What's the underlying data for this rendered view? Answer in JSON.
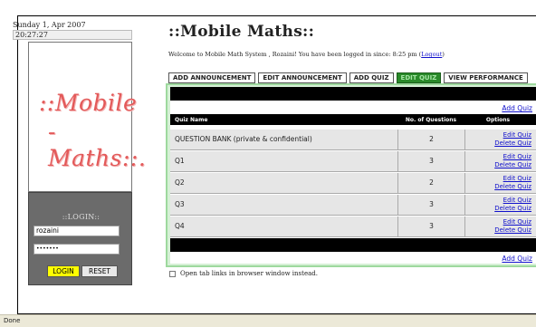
{
  "sidebar": {
    "date": "Sunday 1, Apr 2007",
    "time": "20:27:27",
    "logo": {
      "line1": "::Mobile",
      "line2": "-Maths::."
    },
    "login": {
      "title": "::LOGIN::",
      "username": "rozaini",
      "password_mask": "•••••••",
      "login_label": "LOGIN",
      "reset_label": "RESET"
    }
  },
  "header": {
    "title": "::Mobile Maths::",
    "welcome_text": "Welcome to Mobile Math System , Rozaini! You have been logged in since: 8:25 pm (",
    "logout_label": "Logout",
    "welcome_close": ")"
  },
  "tabs": [
    {
      "label": "ADD ANNOUNCEMENT",
      "active": false
    },
    {
      "label": "EDIT ANNOUNCEMENT",
      "active": false
    },
    {
      "label": "ADD QUIZ",
      "active": false
    },
    {
      "label": "EDIT QUIZ",
      "active": true
    },
    {
      "label": "VIEW PERFORMANCE",
      "active": false
    }
  ],
  "table": {
    "add_quiz_top": "Add Quiz",
    "add_quiz_bottom": "Add Quiz",
    "columns": {
      "name": "Quiz Name",
      "count": "No. of Questions",
      "options": "Options"
    },
    "edit_label": "Edit Quiz",
    "delete_label": "Delete Quiz",
    "rows": [
      {
        "name": "QUESTION BANK (private & confidential)",
        "count": "2"
      },
      {
        "name": "Q1",
        "count": "3"
      },
      {
        "name": "Q2",
        "count": "2"
      },
      {
        "name": "Q3",
        "count": "3"
      },
      {
        "name": "Q4",
        "count": "3"
      }
    ]
  },
  "options": {
    "open_tabs_label": "Open tab links in browser window instead."
  },
  "status_bar": {
    "text": "Done"
  }
}
